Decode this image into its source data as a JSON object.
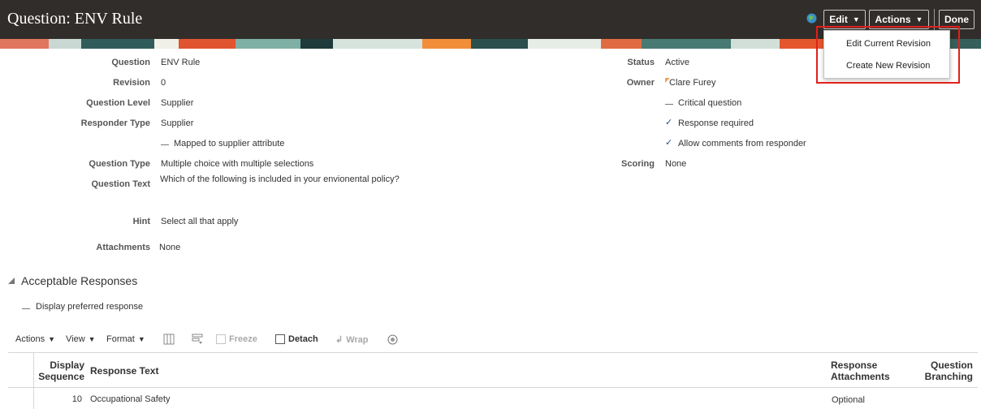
{
  "header": {
    "title": "Question: ENV Rule",
    "edit_label": "Edit",
    "actions_label": "Actions",
    "done_label": "Done",
    "dropdown_items": [
      "Edit Current Revision",
      "Create New Revision"
    ]
  },
  "form": {
    "left": [
      {
        "label": "Question",
        "value": "ENV Rule"
      },
      {
        "label": "Revision",
        "value": "0"
      },
      {
        "label": "Question Level",
        "value": "Supplier"
      },
      {
        "label": "Responder Type",
        "value": "Supplier"
      },
      {
        "label": "Question Type",
        "value": "Multiple choice with multiple selections"
      },
      {
        "label": "Question Text",
        "value": "Which of the following is included in your envionental policy?"
      },
      {
        "label": "Hint",
        "value": "Select all that apply"
      },
      {
        "label": "Attachments",
        "value": "None"
      }
    ],
    "mapped_label": "Mapped to supplier attribute",
    "right": [
      {
        "label": "Status",
        "value": "Active"
      },
      {
        "label": "Owner",
        "value": "Clare Furey"
      },
      {
        "label": "Scoring",
        "value": "None"
      }
    ],
    "critical_label": "Critical question",
    "response_required_label": "Response required",
    "allow_comments_label": "Allow comments from responder"
  },
  "section": {
    "title": "Acceptable Responses",
    "display_preferred_label": "Display preferred response"
  },
  "toolbar": {
    "actions": "Actions",
    "view": "View",
    "format": "Format",
    "freeze": "Freeze",
    "detach": "Detach",
    "wrap": "Wrap"
  },
  "table": {
    "headers": {
      "seq_line1": "Display",
      "seq_line2": "Sequence",
      "response_text": "Response Text",
      "attach_line1": "Response",
      "attach_line2": "Attachments",
      "branch_line1": "Question",
      "branch_line2": "Branching"
    },
    "rows": [
      {
        "seq": "10",
        "text": "Occupational Safety",
        "attachments": "Optional"
      }
    ]
  },
  "colors": {
    "header_bg": "#312d2a",
    "highlight": "#e0201b",
    "check": "#1d4f91"
  }
}
